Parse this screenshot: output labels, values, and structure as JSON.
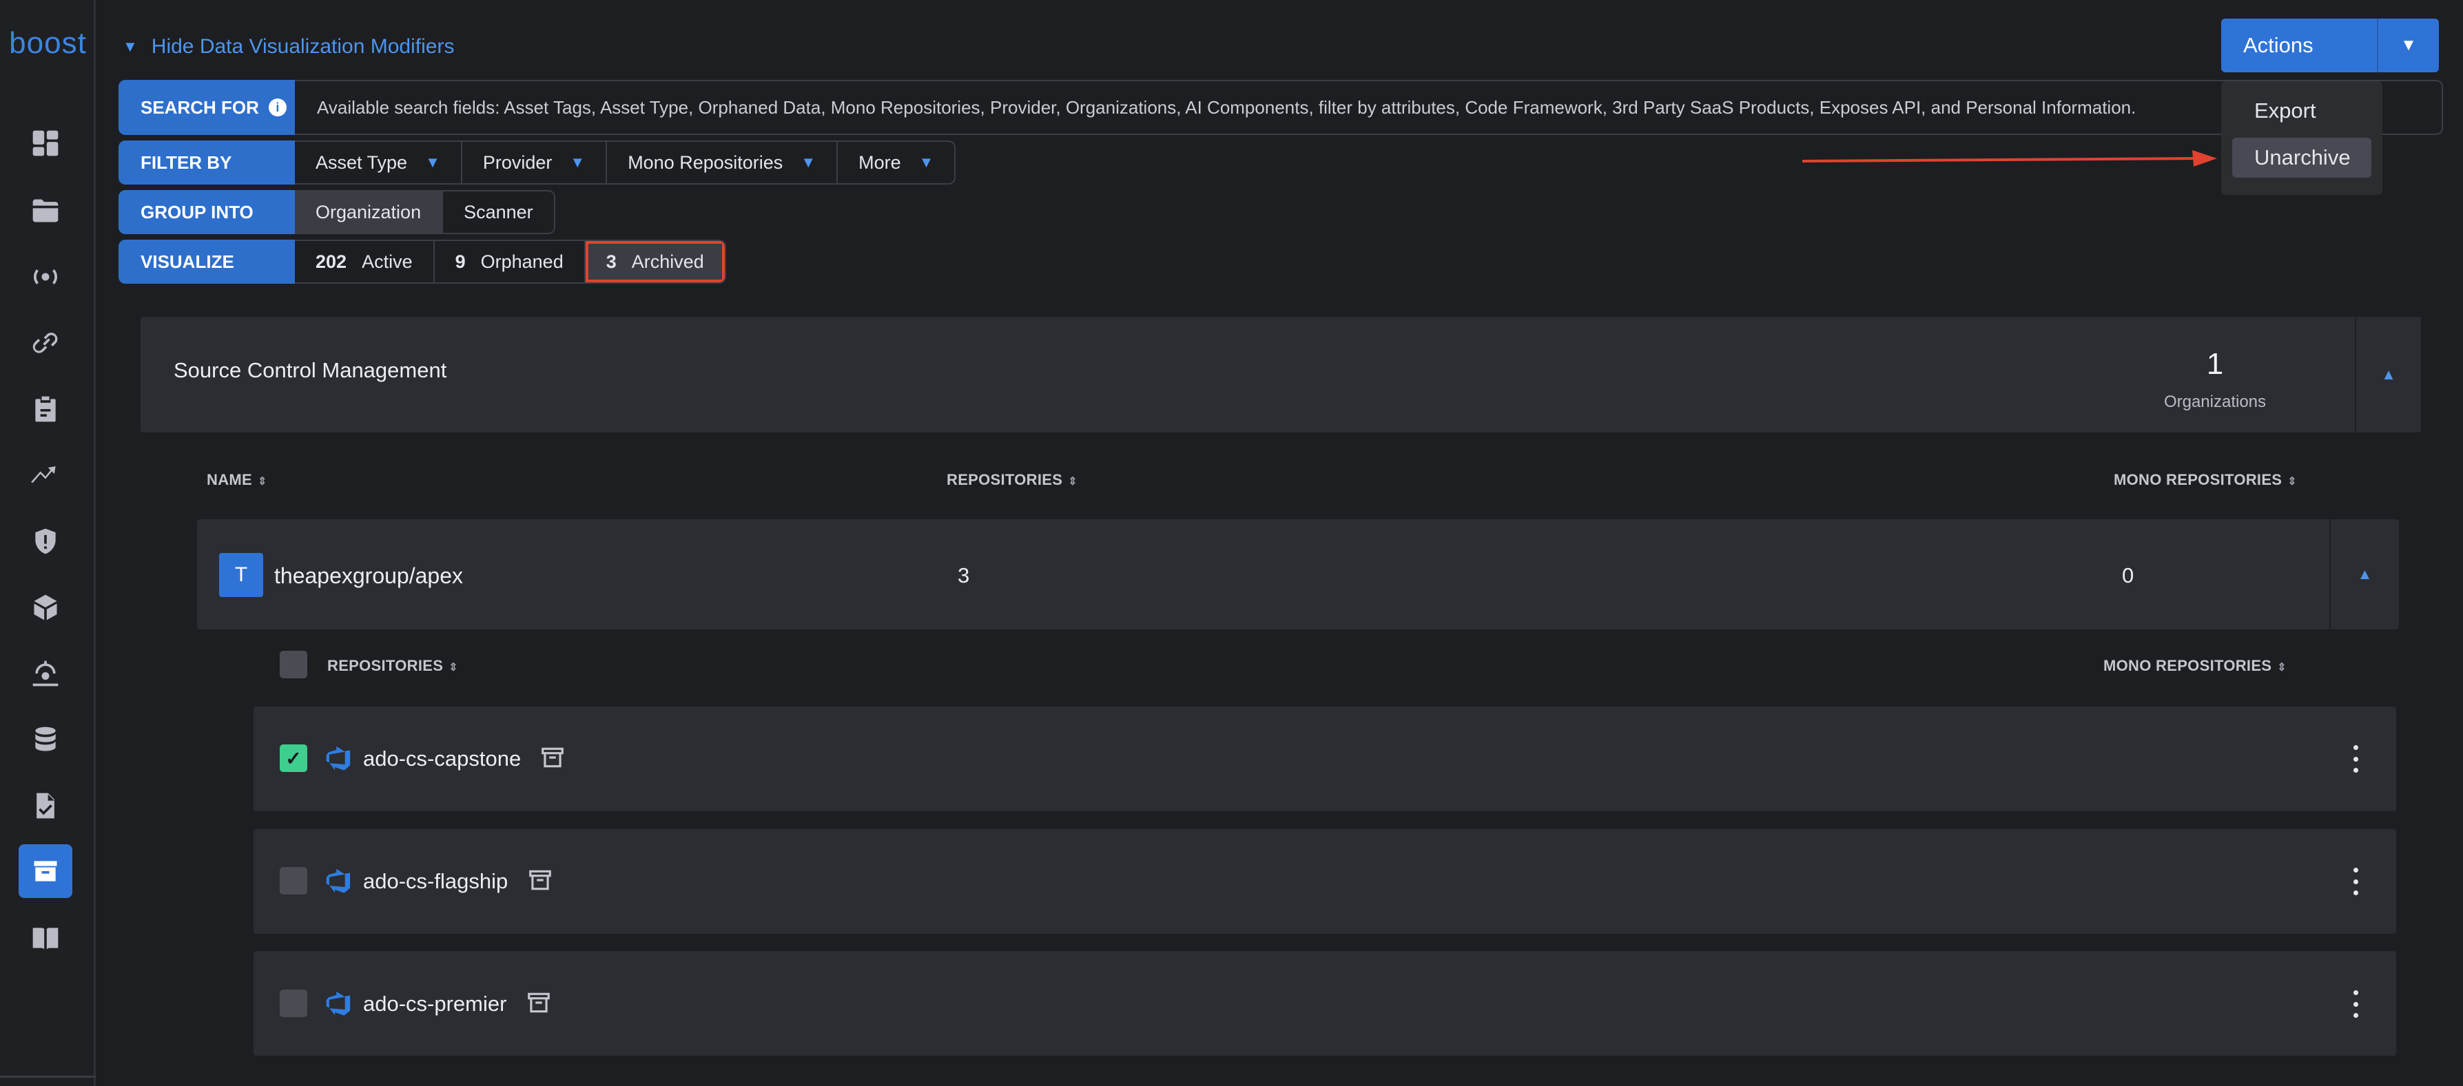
{
  "app": {
    "logo": "boost"
  },
  "sidebar": {
    "items": [
      {
        "icon": "dashboard-icon"
      },
      {
        "icon": "folder-icon"
      },
      {
        "icon": "broadcast-icon"
      },
      {
        "icon": "link-icon"
      },
      {
        "icon": "clipboard-icon"
      },
      {
        "icon": "trend-icon"
      },
      {
        "icon": "shield-icon"
      },
      {
        "icon": "package-icon"
      },
      {
        "icon": "radar-icon"
      },
      {
        "icon": "database-icon"
      },
      {
        "icon": "document-check-icon"
      },
      {
        "icon": "archive-box-icon",
        "active": true
      },
      {
        "icon": "book-icon"
      }
    ]
  },
  "header": {
    "toggle_label": "Hide Data Visualization Modifiers"
  },
  "modifiers": {
    "search": {
      "label": "SEARCH FOR",
      "placeholder": "Available search fields: Asset Tags, Asset Type, Orphaned Data, Mono Repositories, Provider, Organizations, AI Components, filter by attributes, Code Framework, 3rd Party SaaS Products, Exposes API, and Personal Information."
    },
    "filter": {
      "label": "FILTER BY",
      "options": [
        "Asset Type",
        "Provider",
        "Mono Repositories",
        "More"
      ]
    },
    "group": {
      "label": "GROUP INTO",
      "options": [
        "Organization",
        "Scanner"
      ],
      "selected": "Organization"
    },
    "visualize": {
      "label": "VISUALIZE",
      "options": [
        {
          "count": "202",
          "label": "Active"
        },
        {
          "count": "9",
          "label": "Orphaned"
        },
        {
          "count": "3",
          "label": "Archived"
        }
      ],
      "selected": "Archived"
    }
  },
  "actions": {
    "label": "Actions",
    "menu": [
      "Export",
      "Unarchive"
    ],
    "hovered": "Unarchive"
  },
  "scm": {
    "title": "Source Control Management",
    "count": "1",
    "count_label": "Organizations"
  },
  "org_table": {
    "headers": {
      "name": "NAME",
      "repositories": "REPOSITORIES",
      "mono": "MONO REPOSITORIES"
    },
    "row": {
      "avatar": "T",
      "name": "theapexgroup/apex",
      "repositories": "3",
      "mono": "0"
    }
  },
  "repo_table": {
    "headers": {
      "repositories": "REPOSITORIES",
      "mono": "MONO REPOSITORIES"
    },
    "rows": [
      {
        "name": "ado-cs-capstone",
        "checked": true
      },
      {
        "name": "ado-cs-flagship",
        "checked": false
      },
      {
        "name": "ado-cs-premier",
        "checked": false
      }
    ]
  },
  "colors": {
    "accent": "#2f73d6",
    "link": "#4d95ee",
    "highlight": "#e0432f",
    "check": "#3ecf8e",
    "background": "#1d1e21"
  }
}
